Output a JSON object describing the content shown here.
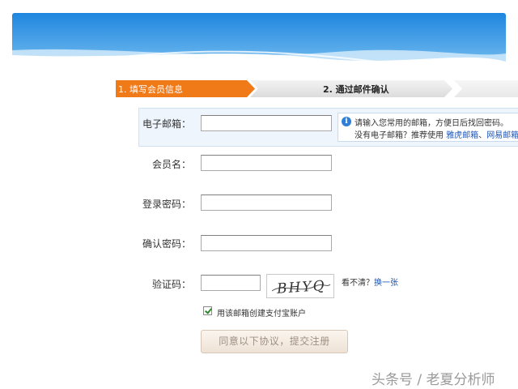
{
  "steps": {
    "step1_label": "1. 填写会员信息",
    "step2_label": "2. 通过邮件确认"
  },
  "form": {
    "email": {
      "label": "电子邮箱：",
      "value": ""
    },
    "member_name": {
      "label": "会员名：",
      "value": ""
    },
    "login_password": {
      "label": "登录密码：",
      "value": ""
    },
    "confirm_password": {
      "label": "确认密码：",
      "value": ""
    },
    "captcha": {
      "label": "验证码：",
      "value": "",
      "image_text": "BHYQ"
    }
  },
  "tip": {
    "line1": "请输入您常用的邮箱，方便日后找回密码。",
    "line2_prefix": "没有电子邮箱？推荐使用",
    "link1": "雅虎邮箱",
    "separator": "、",
    "link2": "网易邮箱"
  },
  "captcha_refresh": {
    "prefix": "看不清？",
    "link": "换一张"
  },
  "alipay_checkbox": {
    "checked": true,
    "label": "用该邮箱创建支付宝账户"
  },
  "submit_label": "同意以下协议，提交注册",
  "watermark": "头条号 / 老夏分析师",
  "colors": {
    "step_active": "#f07a18",
    "banner_blue": "#2a8fe0",
    "link": "#1f56b8"
  }
}
